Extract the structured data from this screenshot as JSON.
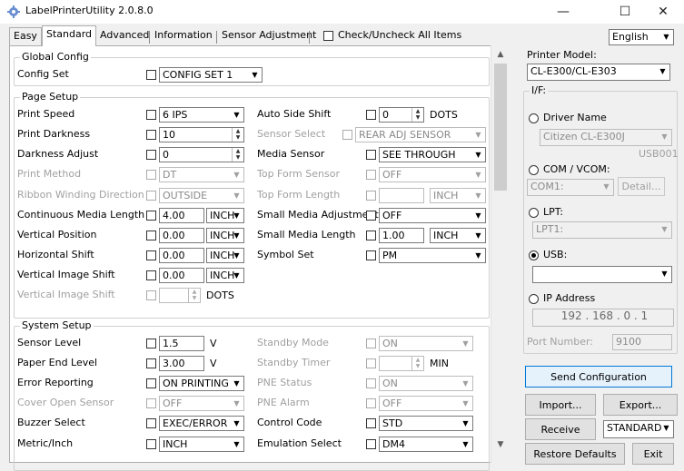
{
  "window": {
    "title": "LabelPrinterUtility 2.0.8.0",
    "minimize": "—",
    "maximize": "☐",
    "close": "✕"
  },
  "tabs": [
    "Easy",
    "Standard",
    "Advanced",
    "Information",
    "Sensor Adjustment"
  ],
  "check_all_label": "Check/Uncheck All Items",
  "language": "English",
  "global": {
    "title": "Global Config",
    "config_set_label": "Config Set",
    "config_set_value": "CONFIG SET 1"
  },
  "page_setup": {
    "title": "Page Setup",
    "print_speed": {
      "label": "Print Speed",
      "value": "6 IPS"
    },
    "print_darkness": {
      "label": "Print Darkness",
      "value": "10"
    },
    "darkness_adjust": {
      "label": "Darkness Adjust",
      "value": "0"
    },
    "print_method": {
      "label": "Print Method",
      "value": "DT"
    },
    "ribbon_winding": {
      "label": "Ribbon Winding Direction",
      "value": "OUTSIDE"
    },
    "continuous_media_length": {
      "label": "Continuous Media Length",
      "value": "4.00",
      "unit": "INCH"
    },
    "vertical_position": {
      "label": "Vertical Position",
      "value": "0.00",
      "unit": "INCH"
    },
    "horizontal_shift": {
      "label": "Horizontal Shift",
      "value": "0.00",
      "unit": "INCH"
    },
    "vertical_image_shift": {
      "label": "Vertical Image Shift",
      "value": "0.00",
      "unit": "INCH"
    },
    "vertical_image_shift_dots": {
      "label": "Vertical Image Shift",
      "value": "",
      "unit": "DOTS"
    },
    "auto_side_shift": {
      "label": "Auto Side Shift",
      "value": "0",
      "unit": "DOTS"
    },
    "sensor_select": {
      "label": "Sensor Select",
      "value": "REAR ADJ SENSOR"
    },
    "media_sensor": {
      "label": "Media Sensor",
      "value": "SEE THROUGH"
    },
    "top_form_sensor": {
      "label": "Top Form Sensor",
      "value": "OFF"
    },
    "top_form_length": {
      "label": "Top Form Length",
      "value": "",
      "unit": "INCH"
    },
    "small_media_adjustment": {
      "label": "Small Media Adjustment",
      "value": "OFF"
    },
    "small_media_length": {
      "label": "Small Media Length",
      "value": "1.00",
      "unit": "INCH"
    },
    "symbol_set": {
      "label": "Symbol Set",
      "value": "PM"
    }
  },
  "system_setup": {
    "title": "System Setup",
    "sensor_level": {
      "label": "Sensor Level",
      "value": "1.5",
      "unit": "V"
    },
    "paper_end_level": {
      "label": "Paper End Level",
      "value": "3.00",
      "unit": "V"
    },
    "error_reporting": {
      "label": "Error Reporting",
      "value": "ON PRINTING"
    },
    "cover_open_sensor": {
      "label": "Cover Open Sensor",
      "value": "OFF"
    },
    "buzzer_select": {
      "label": "Buzzer Select",
      "value": "EXEC/ERROR"
    },
    "metric_inch": {
      "label": "Metric/Inch",
      "value": "INCH"
    },
    "standby_mode": {
      "label": "Standby Mode",
      "value": "ON"
    },
    "standby_timer": {
      "label": "Standby Timer",
      "value": "",
      "unit": "MIN"
    },
    "pne_status": {
      "label": "PNE Status",
      "value": "ON"
    },
    "pne_alarm": {
      "label": "PNE Alarm",
      "value": "OFF"
    },
    "control_code": {
      "label": "Control Code",
      "value": "STD"
    },
    "emulation_select": {
      "label": "Emulation Select",
      "value": "DM4"
    }
  },
  "right": {
    "printer_model_label": "Printer Model:",
    "printer_model": "CL-E300/CL-E303",
    "if_title": "I/F:",
    "driver_name_label": "Driver Name",
    "driver_name_value": "Citizen CL-E300J",
    "usb_port": "USB001",
    "com_label": "COM / VCOM:",
    "com_value": "COM1:",
    "detail_label": "Detail...",
    "lpt_label": "LPT:",
    "lpt_value": "LPT1:",
    "usb_label": "USB:",
    "usb_value": "",
    "ip_label": "IP Address",
    "ip_value": "192 . 168 . 0 . 1",
    "port_label": "Port Number:",
    "port_value": "9100",
    "send_config": "Send Configuration",
    "import": "Import...",
    "export": "Export...",
    "receive": "Receive",
    "receive_mode": "STANDARD",
    "restore": "Restore Defaults",
    "exit": "Exit"
  }
}
